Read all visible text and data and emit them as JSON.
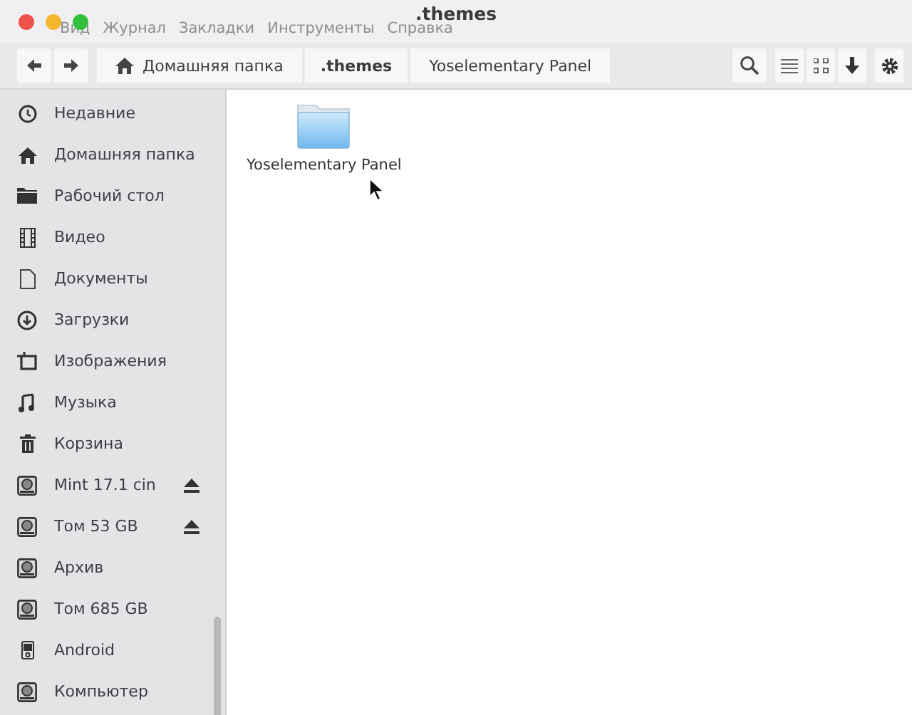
{
  "window": {
    "title": ".themes"
  },
  "ghost_menu": [
    "Вид",
    "Журнал",
    "Закладки",
    "Инструменты",
    "Справка"
  ],
  "breadcrumbs": [
    {
      "label": "Домашняя папка",
      "kind": "home",
      "selected": false
    },
    {
      "label": ".themes",
      "kind": "plain",
      "selected": true
    },
    {
      "label": "Yoselementary Panel",
      "kind": "plain",
      "selected": false
    }
  ],
  "sidebar": {
    "items": [
      {
        "label": "Недавние",
        "kind": "recent",
        "eject": false
      },
      {
        "label": "Домашняя папка",
        "kind": "home",
        "eject": false
      },
      {
        "label": "Рабочий стол",
        "kind": "desktop",
        "eject": false
      },
      {
        "label": "Видео",
        "kind": "video",
        "eject": false
      },
      {
        "label": "Документы",
        "kind": "document",
        "eject": false
      },
      {
        "label": "Загрузки",
        "kind": "download",
        "eject": false
      },
      {
        "label": "Изображения",
        "kind": "picture",
        "eject": false
      },
      {
        "label": "Музыка",
        "kind": "music",
        "eject": false
      },
      {
        "label": "Корзина",
        "kind": "trash",
        "eject": false
      },
      {
        "label": "Mint 17.1 cin",
        "kind": "drive",
        "eject": true
      },
      {
        "label": "Том 53 GB",
        "kind": "drive",
        "eject": true
      },
      {
        "label": "Архив",
        "kind": "drive",
        "eject": false
      },
      {
        "label": "Том 685 GB",
        "kind": "drive",
        "eject": false
      },
      {
        "label": "Android",
        "kind": "phone",
        "eject": false
      },
      {
        "label": "Компьютер",
        "kind": "drive",
        "eject": false
      }
    ]
  },
  "files": [
    {
      "name": "Yoselementary Panel"
    }
  ]
}
